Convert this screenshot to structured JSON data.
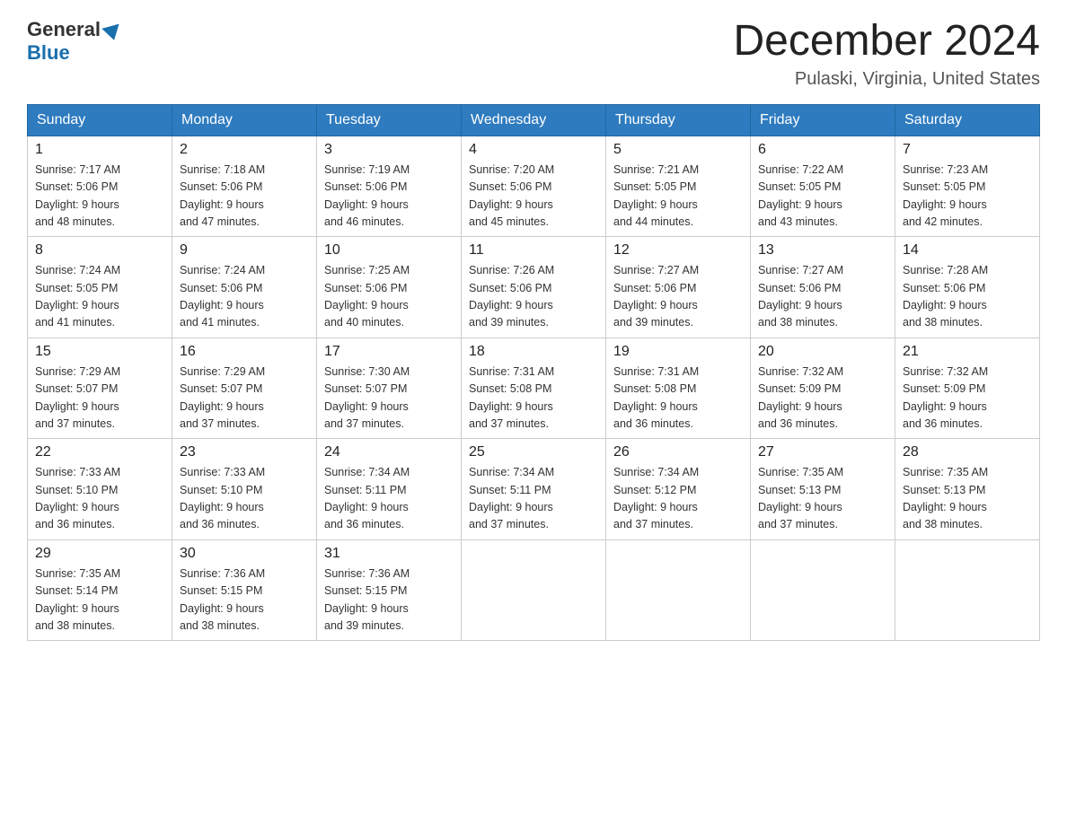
{
  "header": {
    "logo_general": "General",
    "logo_blue": "Blue",
    "month_title": "December 2024",
    "location": "Pulaski, Virginia, United States"
  },
  "weekdays": [
    "Sunday",
    "Monday",
    "Tuesday",
    "Wednesday",
    "Thursday",
    "Friday",
    "Saturday"
  ],
  "weeks": [
    [
      {
        "day": "1",
        "sunrise": "7:17 AM",
        "sunset": "5:06 PM",
        "daylight": "9 hours and 48 minutes."
      },
      {
        "day": "2",
        "sunrise": "7:18 AM",
        "sunset": "5:06 PM",
        "daylight": "9 hours and 47 minutes."
      },
      {
        "day": "3",
        "sunrise": "7:19 AM",
        "sunset": "5:06 PM",
        "daylight": "9 hours and 46 minutes."
      },
      {
        "day": "4",
        "sunrise": "7:20 AM",
        "sunset": "5:06 PM",
        "daylight": "9 hours and 45 minutes."
      },
      {
        "day": "5",
        "sunrise": "7:21 AM",
        "sunset": "5:05 PM",
        "daylight": "9 hours and 44 minutes."
      },
      {
        "day": "6",
        "sunrise": "7:22 AM",
        "sunset": "5:05 PM",
        "daylight": "9 hours and 43 minutes."
      },
      {
        "day": "7",
        "sunrise": "7:23 AM",
        "sunset": "5:05 PM",
        "daylight": "9 hours and 42 minutes."
      }
    ],
    [
      {
        "day": "8",
        "sunrise": "7:24 AM",
        "sunset": "5:05 PM",
        "daylight": "9 hours and 41 minutes."
      },
      {
        "day": "9",
        "sunrise": "7:24 AM",
        "sunset": "5:06 PM",
        "daylight": "9 hours and 41 minutes."
      },
      {
        "day": "10",
        "sunrise": "7:25 AM",
        "sunset": "5:06 PM",
        "daylight": "9 hours and 40 minutes."
      },
      {
        "day": "11",
        "sunrise": "7:26 AM",
        "sunset": "5:06 PM",
        "daylight": "9 hours and 39 minutes."
      },
      {
        "day": "12",
        "sunrise": "7:27 AM",
        "sunset": "5:06 PM",
        "daylight": "9 hours and 39 minutes."
      },
      {
        "day": "13",
        "sunrise": "7:27 AM",
        "sunset": "5:06 PM",
        "daylight": "9 hours and 38 minutes."
      },
      {
        "day": "14",
        "sunrise": "7:28 AM",
        "sunset": "5:06 PM",
        "daylight": "9 hours and 38 minutes."
      }
    ],
    [
      {
        "day": "15",
        "sunrise": "7:29 AM",
        "sunset": "5:07 PM",
        "daylight": "9 hours and 37 minutes."
      },
      {
        "day": "16",
        "sunrise": "7:29 AM",
        "sunset": "5:07 PM",
        "daylight": "9 hours and 37 minutes."
      },
      {
        "day": "17",
        "sunrise": "7:30 AM",
        "sunset": "5:07 PM",
        "daylight": "9 hours and 37 minutes."
      },
      {
        "day": "18",
        "sunrise": "7:31 AM",
        "sunset": "5:08 PM",
        "daylight": "9 hours and 37 minutes."
      },
      {
        "day": "19",
        "sunrise": "7:31 AM",
        "sunset": "5:08 PM",
        "daylight": "9 hours and 36 minutes."
      },
      {
        "day": "20",
        "sunrise": "7:32 AM",
        "sunset": "5:09 PM",
        "daylight": "9 hours and 36 minutes."
      },
      {
        "day": "21",
        "sunrise": "7:32 AM",
        "sunset": "5:09 PM",
        "daylight": "9 hours and 36 minutes."
      }
    ],
    [
      {
        "day": "22",
        "sunrise": "7:33 AM",
        "sunset": "5:10 PM",
        "daylight": "9 hours and 36 minutes."
      },
      {
        "day": "23",
        "sunrise": "7:33 AM",
        "sunset": "5:10 PM",
        "daylight": "9 hours and 36 minutes."
      },
      {
        "day": "24",
        "sunrise": "7:34 AM",
        "sunset": "5:11 PM",
        "daylight": "9 hours and 36 minutes."
      },
      {
        "day": "25",
        "sunrise": "7:34 AM",
        "sunset": "5:11 PM",
        "daylight": "9 hours and 37 minutes."
      },
      {
        "day": "26",
        "sunrise": "7:34 AM",
        "sunset": "5:12 PM",
        "daylight": "9 hours and 37 minutes."
      },
      {
        "day": "27",
        "sunrise": "7:35 AM",
        "sunset": "5:13 PM",
        "daylight": "9 hours and 37 minutes."
      },
      {
        "day": "28",
        "sunrise": "7:35 AM",
        "sunset": "5:13 PM",
        "daylight": "9 hours and 38 minutes."
      }
    ],
    [
      {
        "day": "29",
        "sunrise": "7:35 AM",
        "sunset": "5:14 PM",
        "daylight": "9 hours and 38 minutes."
      },
      {
        "day": "30",
        "sunrise": "7:36 AM",
        "sunset": "5:15 PM",
        "daylight": "9 hours and 38 minutes."
      },
      {
        "day": "31",
        "sunrise": "7:36 AM",
        "sunset": "5:15 PM",
        "daylight": "9 hours and 39 minutes."
      },
      null,
      null,
      null,
      null
    ]
  ]
}
